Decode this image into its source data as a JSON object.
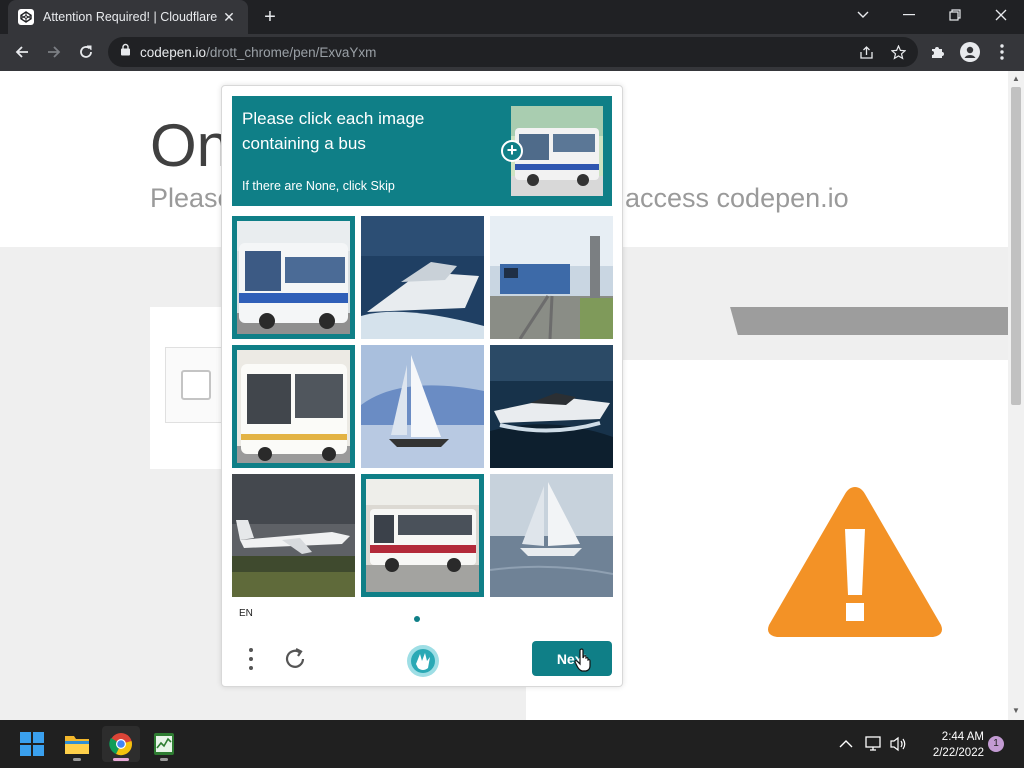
{
  "browser": {
    "tab_title": "Attention Required! | Cloudflare",
    "new_tab_label": "+",
    "url_domain": "codepen.io",
    "url_path": "/drott_chrome/pen/ExvaYxm"
  },
  "page": {
    "hero_title": "On",
    "hero_subtitle_left": "Please",
    "hero_subtitle_right": "access codepen.io"
  },
  "captcha": {
    "prompt": "Please click each image containing a bus",
    "prompt_sub": "If there are None, click Skip",
    "language": "EN",
    "next_label": "Next",
    "images": [
      {
        "subject": "bus",
        "selected": true
      },
      {
        "subject": "boat",
        "selected": false
      },
      {
        "subject": "train",
        "selected": false
      },
      {
        "subject": "bus",
        "selected": true
      },
      {
        "subject": "sailboat",
        "selected": false
      },
      {
        "subject": "speedboat",
        "selected": false
      },
      {
        "subject": "airplane",
        "selected": false
      },
      {
        "subject": "bus",
        "selected": true
      },
      {
        "subject": "sailboat",
        "selected": false
      }
    ],
    "accent_color": "#0f7f87"
  },
  "taskbar": {
    "time": "2:44 AM",
    "date": "2/22/2022",
    "notification_count": "1"
  }
}
